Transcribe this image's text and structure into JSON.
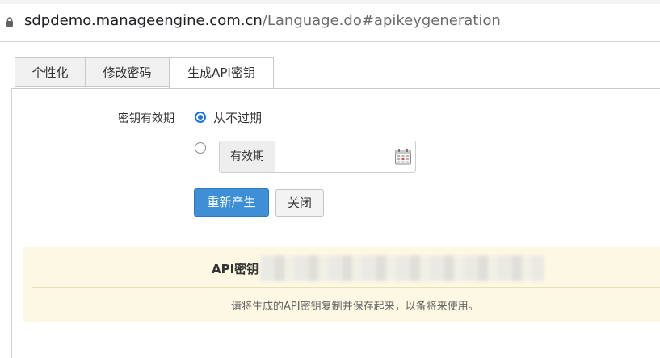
{
  "browser": {
    "url_host": "sdpdemo.manageengine.com.cn",
    "url_path": "/Language.do#apikeygeneration"
  },
  "tabs": [
    {
      "label": "个性化",
      "active": false
    },
    {
      "label": "修改密码",
      "active": false
    },
    {
      "label": "生成API密钥",
      "active": true
    }
  ],
  "form": {
    "validity_label": "密钥有效期",
    "option_never": "从不过期",
    "option_validity_addon": "有效期",
    "validity_date_value": "",
    "selected_option": "never"
  },
  "buttons": {
    "regenerate": "重新产生",
    "close": "关闭"
  },
  "api_key": {
    "label": "API密钥",
    "hint": "请将生成的API密钥复制并保存起来，以备将来使用。"
  },
  "colors": {
    "primary_button": "#3e8fd6",
    "notice_background": "#fcf8e3",
    "radio_checked": "#1a73e8"
  }
}
